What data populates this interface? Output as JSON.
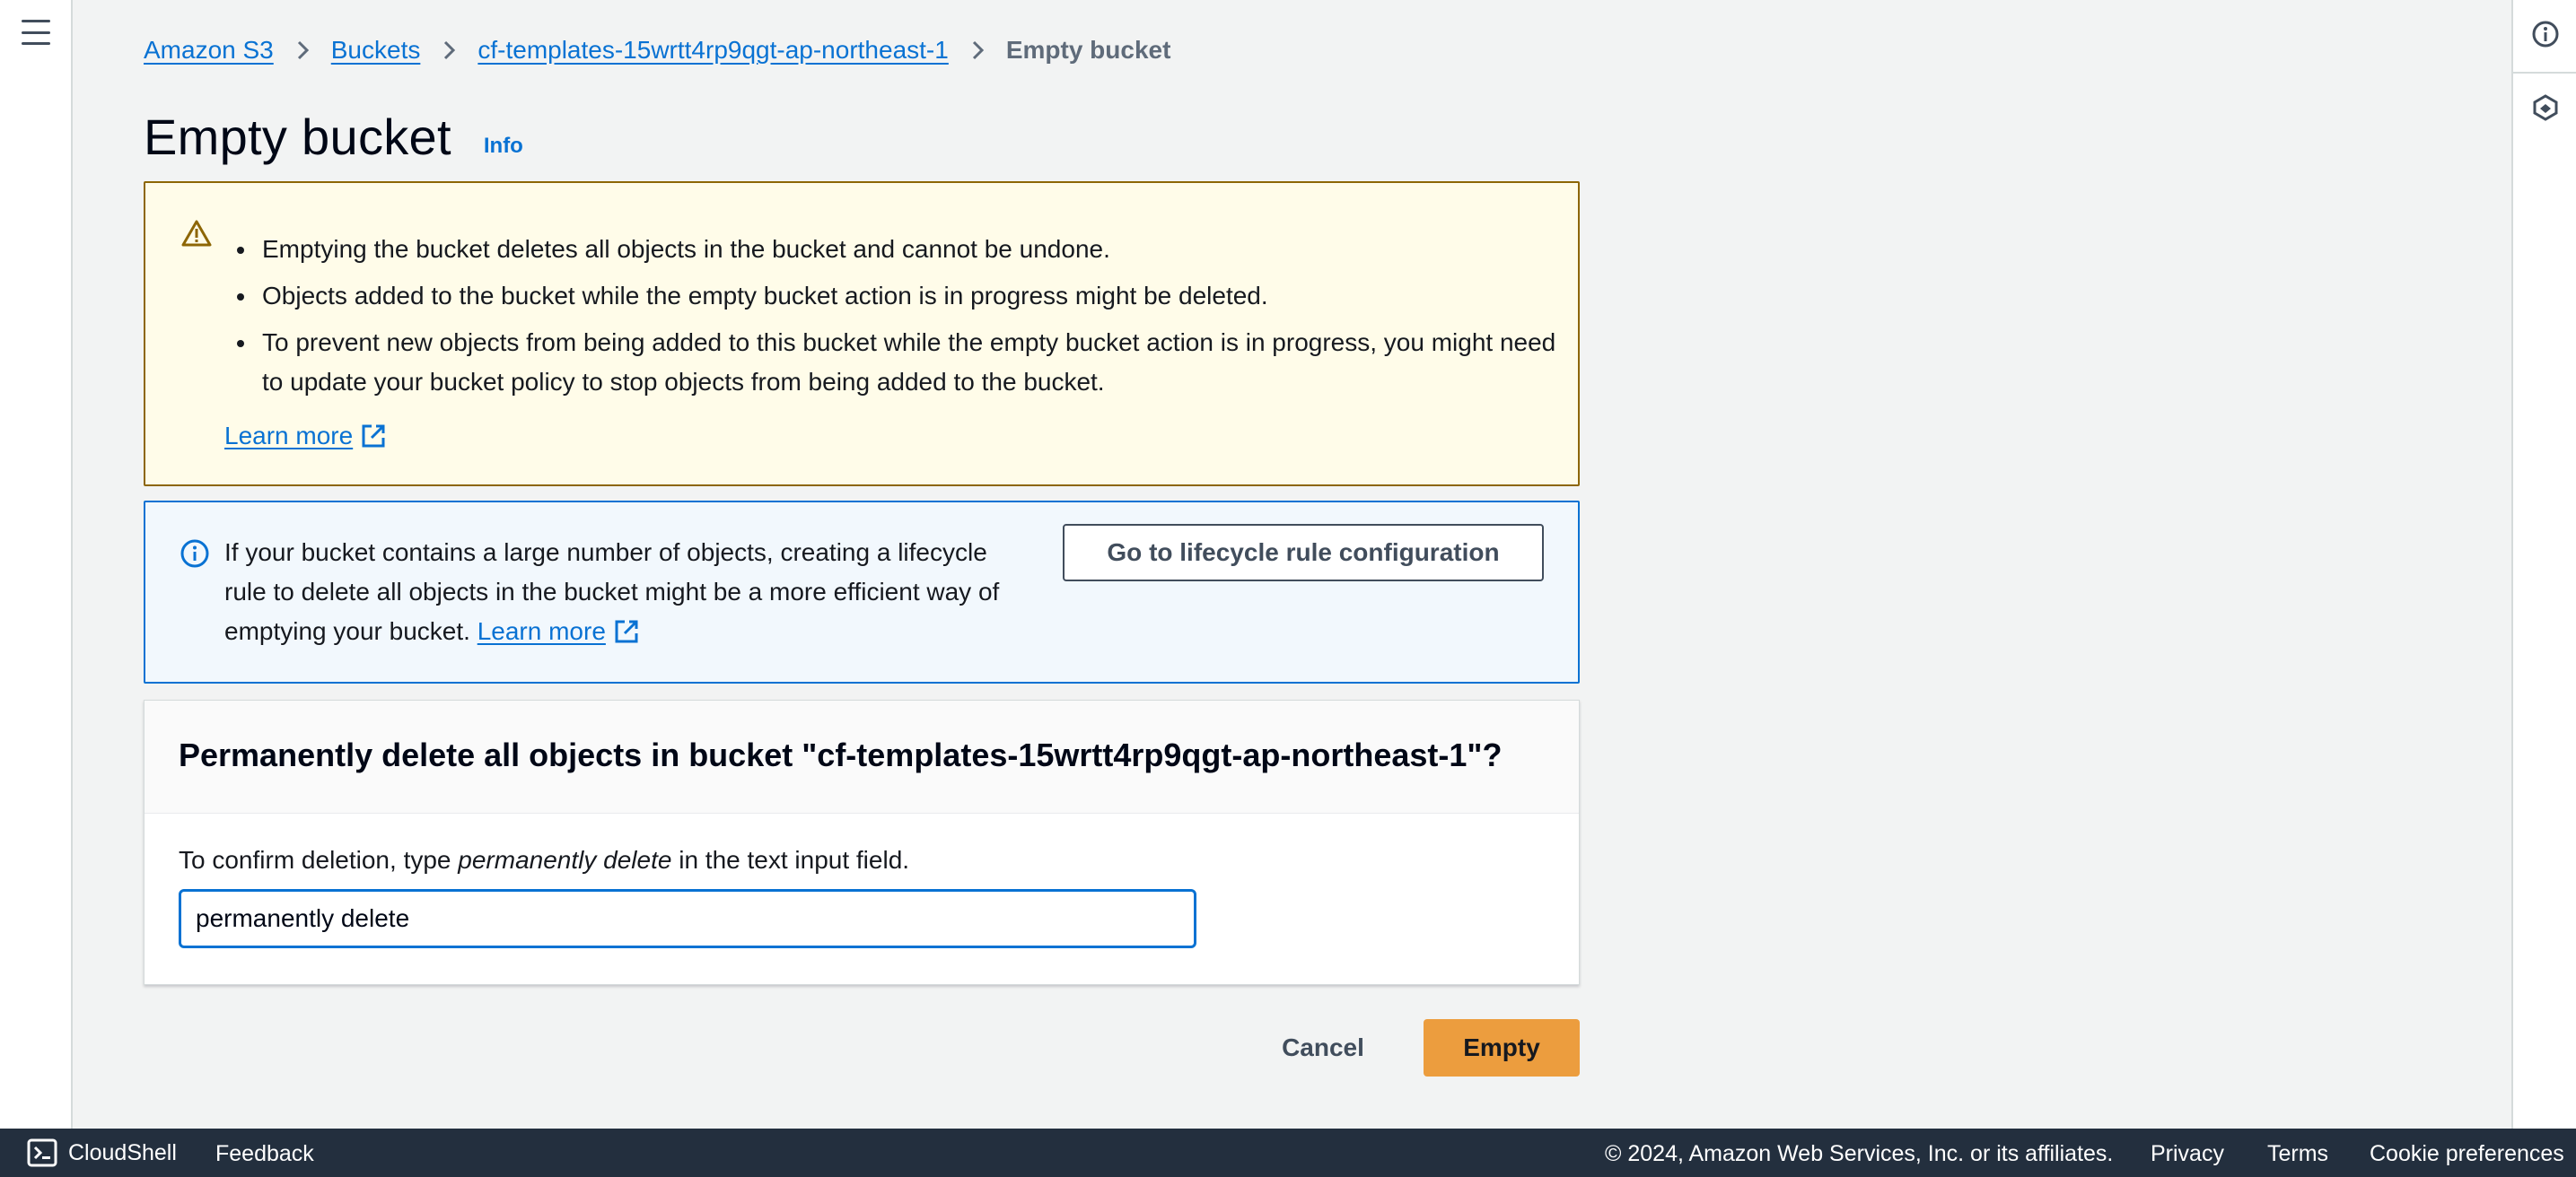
{
  "breadcrumb": {
    "items": [
      "Amazon S3",
      "Buckets",
      "cf-templates-15wrtt4rp9qgt-ap-northeast-1"
    ],
    "current": "Empty bucket"
  },
  "page": {
    "title": "Empty bucket",
    "info_link": "Info"
  },
  "warning_alert": {
    "bullets": [
      "Emptying the bucket deletes all objects in the bucket and cannot be undone.",
      "Objects added to the bucket while the empty bucket action is in progress might be deleted.",
      "To prevent new objects from being added to this bucket while the empty bucket action is in progress, you might need to update your bucket policy to stop objects from being added to the bucket."
    ],
    "learn_more": "Learn more"
  },
  "info_alert": {
    "text": "If your bucket contains a large number of objects, creating a lifecycle rule to delete all objects in the bucket might be a more efficient way of emptying your bucket.",
    "learn_more": "Learn more",
    "button_label": "Go to lifecycle rule configuration"
  },
  "confirm": {
    "heading": "Permanently delete all objects in bucket \"cf-templates-15wrtt4rp9qgt-ap-northeast-1\"?",
    "instruction_prefix": "To confirm deletion, type ",
    "instruction_phrase": "permanently delete",
    "instruction_suffix": " in the text input field.",
    "input_value": "permanently delete"
  },
  "actions": {
    "cancel_label": "Cancel",
    "empty_label": "Empty"
  },
  "footer": {
    "cloudshell": "CloudShell",
    "feedback": "Feedback",
    "copyright": "© 2024, Amazon Web Services, Inc. or its affiliates.",
    "privacy": "Privacy",
    "terms": "Terms",
    "cookie_preferences": "Cookie preferences"
  },
  "icons": {
    "menu": "hamburger-menu-icon",
    "info_panel": "info-circle-icon",
    "ai_assistant": "hexagon-assistant-icon",
    "warning": "warning-triangle-icon",
    "info": "info-circle-icon",
    "external": "external-link-icon",
    "breadcrumb_separator": "chevron-right-icon",
    "cloudshell": "cloudshell-terminal-icon"
  },
  "colors": {
    "link": "#0972d3",
    "primary_button": "#ec9d3e",
    "warning_bg": "#fffce9",
    "warning_border": "#8d6605",
    "info_bg": "#f2f8fd",
    "footer_bg": "#232f3e"
  }
}
